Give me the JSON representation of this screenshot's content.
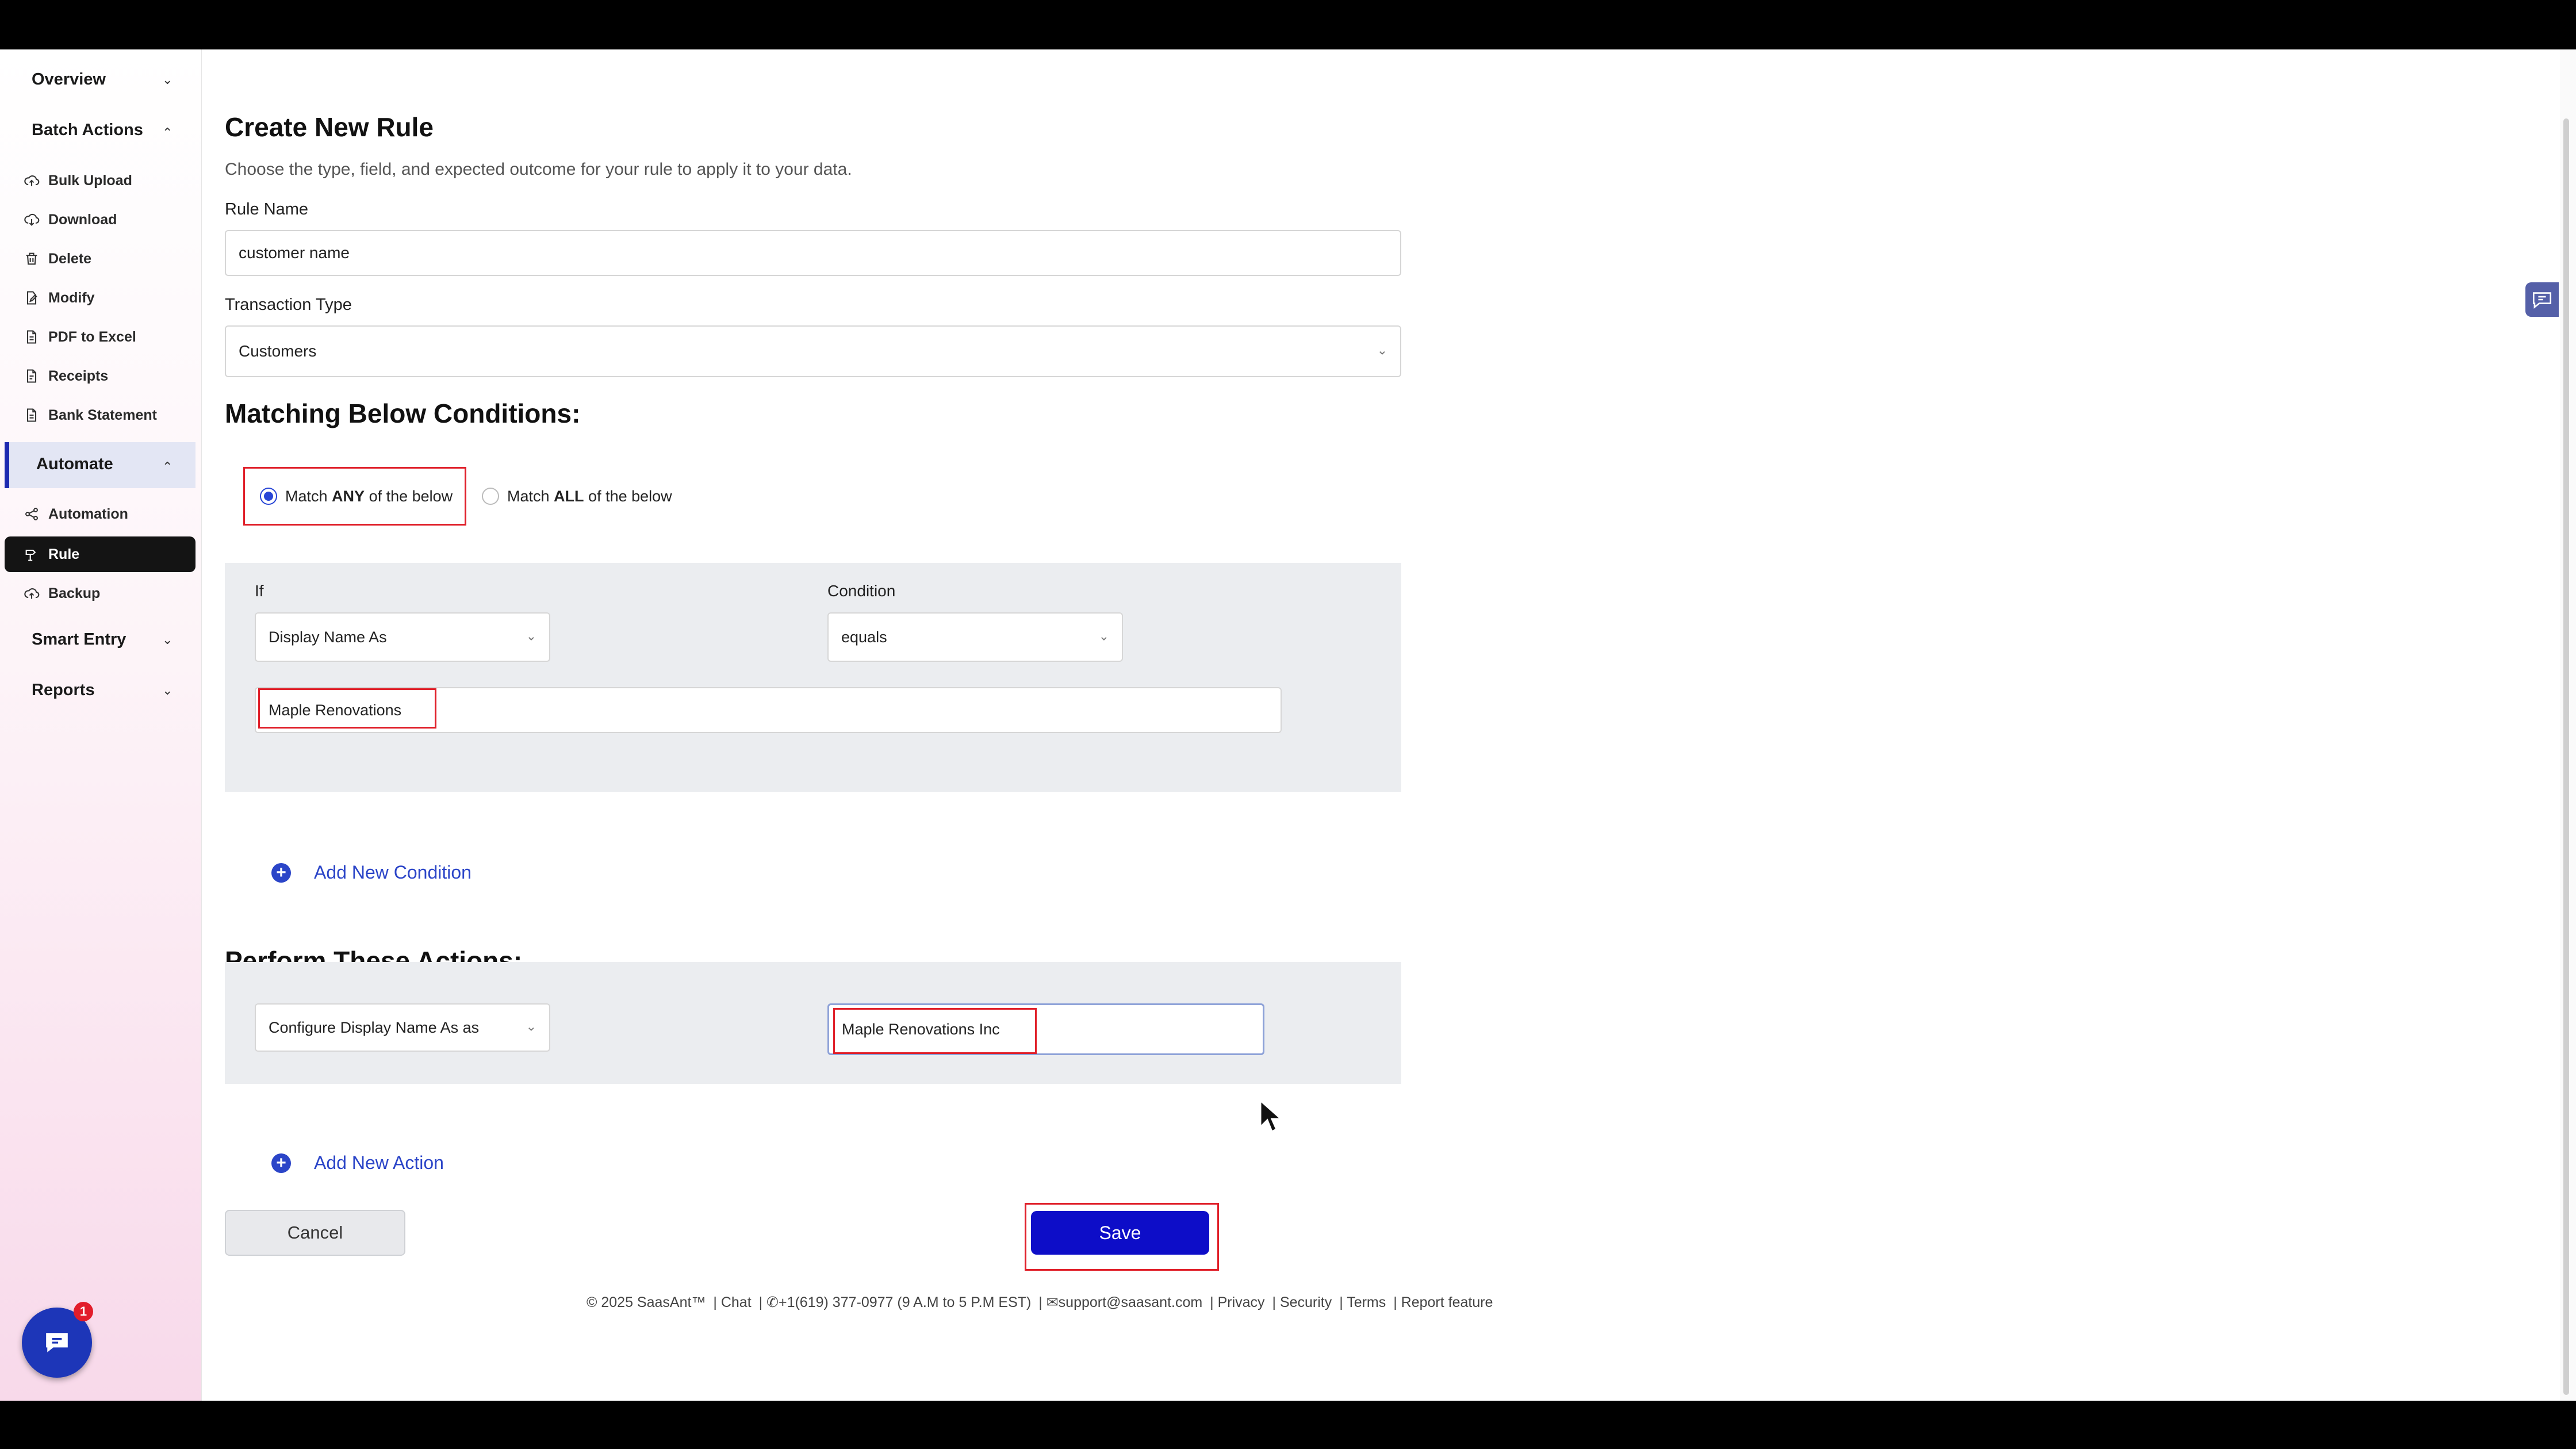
{
  "sidebar": {
    "groups": {
      "overview": "Overview",
      "batch_actions": "Batch Actions",
      "automate": "Automate",
      "smart_entry": "Smart Entry",
      "reports": "Reports"
    },
    "items": {
      "bulk_upload": "Bulk Upload",
      "download": "Download",
      "delete": "Delete",
      "modify": "Modify",
      "pdf_to_excel": "PDF to Excel",
      "receipts": "Receipts",
      "bank_statement": "Bank Statement",
      "automation": "Automation",
      "rule": "Rule",
      "backup": "Backup"
    },
    "active_item": "Rule"
  },
  "form": {
    "title": "Create New Rule",
    "subtitle": "Choose the type, field, and expected outcome for your rule to apply it to your data.",
    "rule_name_label": "Rule Name",
    "rule_name_value": "customer name",
    "transaction_type_label": "Transaction Type",
    "transaction_type_value": "Customers"
  },
  "conditions": {
    "heading": "Matching Below Conditions:",
    "match_any_prefix": "Match",
    "match_any_bold": "ANY",
    "match_any_suffix": "of the below",
    "match_all_prefix": "Match",
    "match_all_bold": "ALL",
    "match_all_suffix": "of the below",
    "selected": "any",
    "if_label": "If",
    "if_value": "Display Name As",
    "condition_label": "Condition",
    "condition_value": "equals",
    "value": "Maple Renovations",
    "add_label": "Add New Condition"
  },
  "actions": {
    "heading": "Perform These Actions:",
    "action_field": "Configure Display Name As as",
    "action_value": "Maple Renovations Inc",
    "add_label": "Add New Action"
  },
  "buttons": {
    "cancel": "Cancel",
    "save": "Save"
  },
  "footer": {
    "copyright": "© 2025 SaasAnt™",
    "chat": "| Chat",
    "phone": "| ✆+1(619) 377-0977 (9 A.M to 5 P.M EST)",
    "email": "| ✉support@saasant.com",
    "privacy": "| Privacy",
    "security": "| Security",
    "terms": "| Terms",
    "report": "| Report feature"
  },
  "chat_widget": {
    "badge_count": "1"
  },
  "colors": {
    "accent": "#2b45c8",
    "save_button": "#0d0dc8",
    "highlight_box": "#e0202a",
    "active_nav": "#141414"
  }
}
